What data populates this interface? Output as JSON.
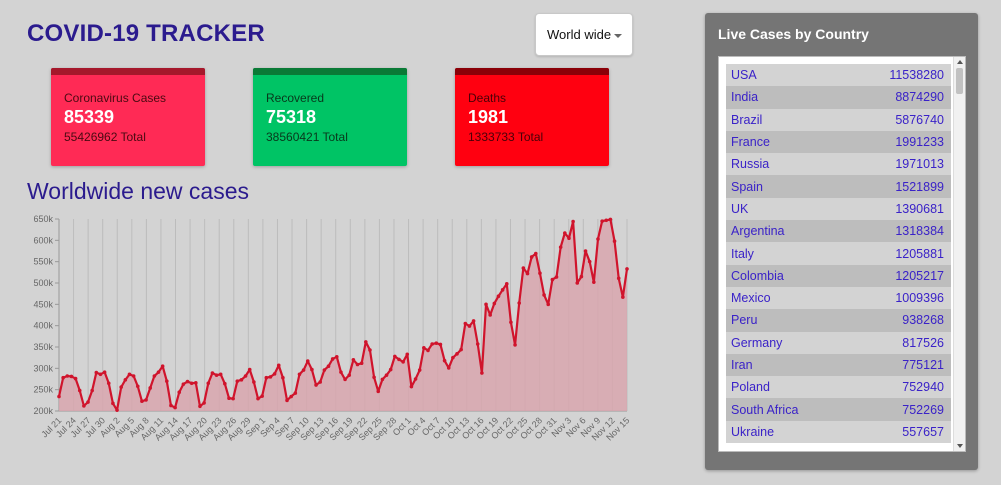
{
  "header": {
    "title": "COVID-19 TRACKER"
  },
  "country_select": {
    "selected": "World wide"
  },
  "cards": {
    "cases": {
      "label": "Coronavirus Cases",
      "value": "85339",
      "total": "55426962 Total"
    },
    "recovered": {
      "label": "Recovered",
      "value": "75318",
      "total": "38560421 Total"
    },
    "deaths": {
      "label": "Deaths",
      "value": "1981",
      "total": "1333733 Total"
    }
  },
  "colors": {
    "title": "#2b1b8e",
    "cases": "#ff2a55",
    "recovered": "#00c465",
    "deaths": "#ff0010",
    "line": "#d0142c",
    "area": "#d8a6ae",
    "panel": "#757575"
  },
  "chart_title": "Worldwide new cases",
  "chart_data": {
    "type": "area",
    "title": "Worldwide new cases",
    "ylim": [
      200000,
      650000
    ],
    "yticks": [
      "200k",
      "250k",
      "300k",
      "350k",
      "400k",
      "450k",
      "500k",
      "550k",
      "600k",
      "650k"
    ],
    "xtick_labels": [
      "Jul 21",
      "Jul 24",
      "Jul 27",
      "Jul 30",
      "Aug 2",
      "Aug 5",
      "Aug 8",
      "Aug 11",
      "Aug 14",
      "Aug 17",
      "Aug 20",
      "Aug 23",
      "Aug 26",
      "Aug 29",
      "Sep 1",
      "Sep 4",
      "Sep 7",
      "Sep 10",
      "Sep 13",
      "Sep 16",
      "Sep 19",
      "Sep 22",
      "Sep 25",
      "Sep 28",
      "Oct 1",
      "Oct 4",
      "Oct 7",
      "Oct 10",
      "Oct 13",
      "Oct 16",
      "Oct 19",
      "Oct 22",
      "Oct 25",
      "Oct 28",
      "Oct 31",
      "Nov 3",
      "Nov 6",
      "Nov 9",
      "Nov 12",
      "Nov 15"
    ],
    "grid": true,
    "series": [
      {
        "values": [
          234000,
          278000,
          282000,
          281000,
          276000,
          248000,
          212000,
          221000,
          248000,
          290000,
          286000,
          291000,
          265000,
          218000,
          202000,
          256000,
          273000,
          286000,
          282000,
          258000,
          223000,
          226000,
          254000,
          282000,
          291000,
          305000,
          270000,
          213000,
          208000,
          244000,
          263000,
          269000,
          265000,
          266000,
          211000,
          219000,
          265000,
          289000,
          284000,
          286000,
          264000,
          230000,
          229000,
          270000,
          273000,
          282000,
          297000,
          268000,
          229000,
          235000,
          278000,
          280000,
          287000,
          307000,
          278000,
          225000,
          234000,
          242000,
          286000,
          296000,
          317000,
          297000,
          261000,
          268000,
          296000,
          305000,
          322000,
          327000,
          291000,
          274000,
          284000,
          320000,
          309000,
          312000,
          362000,
          343000,
          279000,
          246000,
          274000,
          284000,
          297000,
          328000,
          321000,
          315000,
          333000,
          257000,
          275000,
          296000,
          348000,
          342000,
          357000,
          359000,
          356000,
          318000,
          301000,
          325000,
          334000,
          344000,
          405000,
          399000,
          411000,
          357000,
          289000,
          450000,
          425000,
          452000,
          469000,
          484000,
          498000,
          408000,
          355000,
          453000,
          535000,
          522000,
          561000,
          569000,
          523000,
          472000,
          450000,
          508000,
          514000,
          584000,
          617000,
          605000,
          644000,
          500000,
          515000,
          575000,
          550000,
          502000,
          603000,
          645000,
          647000,
          649000,
          598000,
          511000,
          467000,
          533000
        ]
      }
    ]
  },
  "countries": {
    "title": "Live Cases by Country",
    "rows": [
      {
        "name": "USA",
        "cases": "11538280"
      },
      {
        "name": "India",
        "cases": "8874290"
      },
      {
        "name": "Brazil",
        "cases": "5876740"
      },
      {
        "name": "France",
        "cases": "1991233"
      },
      {
        "name": "Russia",
        "cases": "1971013"
      },
      {
        "name": "Spain",
        "cases": "1521899"
      },
      {
        "name": "UK",
        "cases": "1390681"
      },
      {
        "name": "Argentina",
        "cases": "1318384"
      },
      {
        "name": "Italy",
        "cases": "1205881"
      },
      {
        "name": "Colombia",
        "cases": "1205217"
      },
      {
        "name": "Mexico",
        "cases": "1009396"
      },
      {
        "name": "Peru",
        "cases": "938268"
      },
      {
        "name": "Germany",
        "cases": "817526"
      },
      {
        "name": "Iran",
        "cases": "775121"
      },
      {
        "name": "Poland",
        "cases": "752940"
      },
      {
        "name": "South Africa",
        "cases": "752269"
      },
      {
        "name": "Ukraine",
        "cases": "557657"
      }
    ]
  }
}
